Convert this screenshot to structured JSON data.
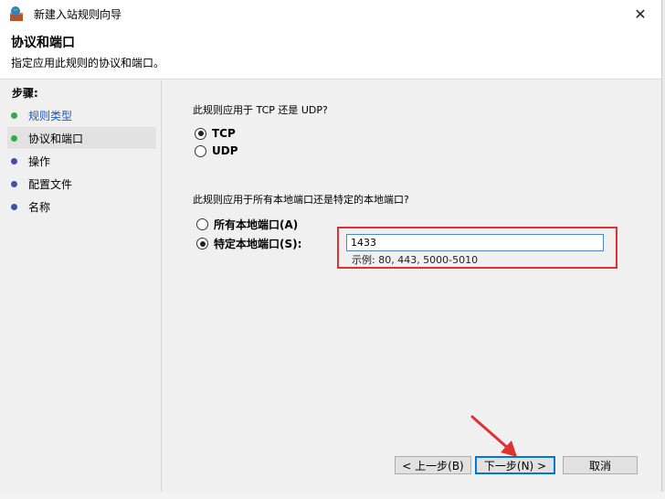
{
  "window": {
    "title": "新建入站规则向导",
    "close_glyph": "✕"
  },
  "header": {
    "title": "协议和端口",
    "subtitle": "指定应用此规则的协议和端口。"
  },
  "sidebar": {
    "label": "步骤:",
    "items": [
      {
        "label": "规则类型",
        "dot_color": "#3aa84a"
      },
      {
        "label": "协议和端口",
        "dot_color": "#3aa84a"
      },
      {
        "label": "操作",
        "dot_color": "#3d4fb0"
      },
      {
        "label": "配置文件",
        "dot_color": "#3d4fb0"
      },
      {
        "label": "名称",
        "dot_color": "#3d4fb0"
      }
    ]
  },
  "protocol": {
    "question": "此规则应用于 TCP 还是 UDP?",
    "options": [
      "TCP",
      "UDP"
    ],
    "selected": "TCP"
  },
  "ports": {
    "question": "此规则应用于所有本地端口还是特定的本地端口?",
    "options": [
      "所有本地端口(A)",
      "特定本地端口(S):"
    ],
    "selected": "特定本地端口(S):",
    "value": "1433",
    "example": "示例: 80, 443, 5000-5010"
  },
  "buttons": {
    "back": "< 上一步(B)",
    "next": "下一步(N) >",
    "cancel": "取消"
  },
  "colors": {
    "highlight": "#e03131",
    "link": "#1a56c8"
  }
}
